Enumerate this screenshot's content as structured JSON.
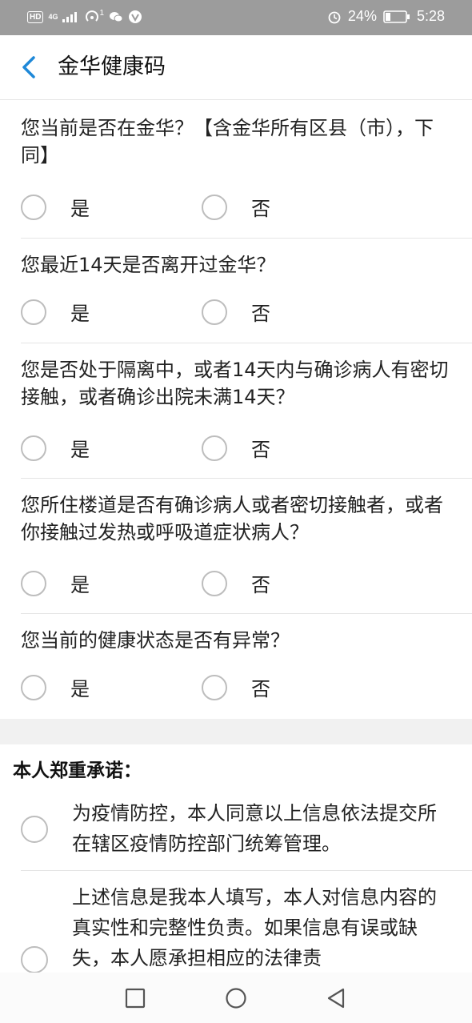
{
  "status_bar": {
    "hd": "HD",
    "network": "4G",
    "hotspot_count": "1",
    "battery_percent": "24%",
    "time": "5:28"
  },
  "header": {
    "title": "金华健康码"
  },
  "questions": [
    {
      "text": "您当前是否在金华？【含金华所有区县（市），下同】",
      "options": [
        "是",
        "否"
      ]
    },
    {
      "text": "您最近14天是否离开过金华？",
      "options": [
        "是",
        "否"
      ]
    },
    {
      "text": "您是否处于隔离中，或者14天内与确诊病人有密切接触，或者确诊出院未满14天？",
      "options": [
        "是",
        "否"
      ]
    },
    {
      "text": "您所住楼道是否有确诊病人或者密切接触者，或者你接触过发热或呼吸道症状病人？",
      "options": [
        "是",
        "否"
      ]
    },
    {
      "text": "您当前的健康状态是否有异常？",
      "options": [
        "是",
        "否"
      ]
    }
  ],
  "promise": {
    "title": "本人郑重承诺：",
    "items": [
      "为疫情防控，本人同意以上信息依法提交所在辖区疫情防控部门统筹管理。",
      "上述信息是我本人填写，本人对信息内容的真实性和完整性负责。如果信息有误或缺失，本人愿承担相应的法律责"
    ]
  },
  "colors": {
    "accent_back": "#1e88d8",
    "status_bar_bg": "#9c9c9c",
    "radio_border": "#bdbdbd",
    "section_gap": "#f1f1f1"
  },
  "icons": {
    "back": "chevron-left-icon",
    "nav_recent": "square-icon",
    "nav_home": "circle-icon",
    "nav_back": "triangle-back-icon"
  }
}
